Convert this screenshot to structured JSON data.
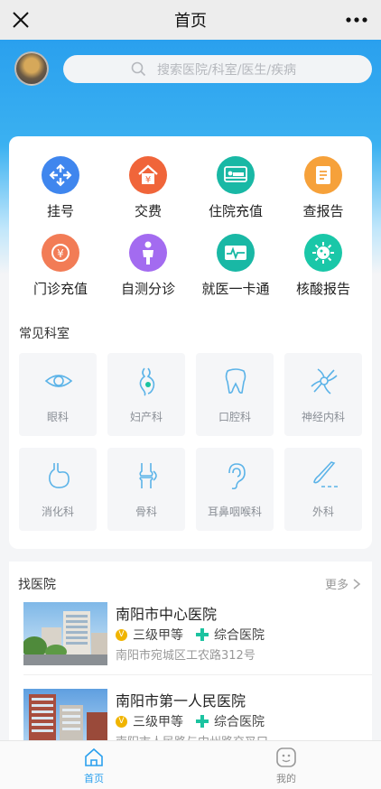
{
  "topbar": {
    "title": "首页",
    "close_icon": "close-icon",
    "more_icon": "more-dots-icon"
  },
  "search": {
    "placeholder": "搜索医院/科室/医生/疾病"
  },
  "quick_actions": [
    {
      "label": "挂号",
      "icon": "register-icon",
      "color": "#3f86ee"
    },
    {
      "label": "交费",
      "icon": "payment-icon",
      "color": "#f0653a"
    },
    {
      "label": "住院充值",
      "icon": "hospital-bed-icon",
      "color": "#19b8a5"
    },
    {
      "label": "查报告",
      "icon": "report-icon",
      "color": "#f6a13a"
    },
    {
      "label": "门诊充值",
      "icon": "outpatient-recharge-icon",
      "color": "#f27c56"
    },
    {
      "label": "自测分诊",
      "icon": "self-triage-icon",
      "color": "#a36bf0"
    },
    {
      "label": "就医一卡通",
      "icon": "medical-card-icon",
      "color": "#19b8a5"
    },
    {
      "label": "核酸报告",
      "icon": "virus-icon",
      "color": "#1ac7a8"
    }
  ],
  "common_departments": {
    "title": "常见科室",
    "items": [
      {
        "label": "眼科",
        "icon": "eye-icon"
      },
      {
        "label": "妇产科",
        "icon": "pregnancy-icon"
      },
      {
        "label": "口腔科",
        "icon": "tooth-icon"
      },
      {
        "label": "神经内科",
        "icon": "neuron-icon"
      },
      {
        "label": "消化科",
        "icon": "stomach-icon"
      },
      {
        "label": "骨科",
        "icon": "bone-joint-icon"
      },
      {
        "label": "耳鼻咽喉科",
        "icon": "ear-icon"
      },
      {
        "label": "外科",
        "icon": "scalpel-icon"
      }
    ]
  },
  "hospitals": {
    "title": "找医院",
    "more_label": "更多",
    "items": [
      {
        "name": "南阳市中心医院",
        "level": "三级甲等",
        "type": "综合医院",
        "address": "南阳市宛城区工农路312号"
      },
      {
        "name": "南阳市第一人民医院",
        "level": "三级甲等",
        "type": "综合医院",
        "address": "南阳市人民路与中州路交叉口"
      }
    ]
  },
  "bottom_nav": [
    {
      "label": "首页",
      "icon": "home-icon",
      "active": true
    },
    {
      "label": "我的",
      "icon": "face-icon",
      "active": false
    }
  ],
  "colors": {
    "accent": "#2aa0ee",
    "active_nav": "#2aa0ee"
  }
}
